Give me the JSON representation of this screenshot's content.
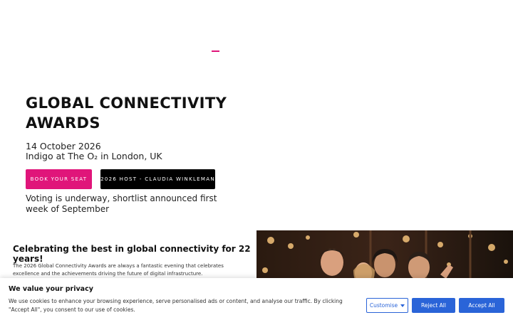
{
  "hero": {
    "title": "GLOBAL CONNECTIVITY AWARDS",
    "date": " 14 October 2026",
    "venue": "Indigo at The O₂ in London, UK",
    "book_label": "BOOK YOUR SEAT",
    "host_label": "2026 HOST - CLAUDIA WINKLEMAN",
    "note": "Voting is underway, shortlist announced first week of September"
  },
  "section": {
    "heading": "Celebrating the best in global connectivity for 22 years!",
    "body": "The 2026 Global Connectivity Awards are always a fantastic evening that celebrates excellence and the achievements driving the future of digital infrastructure."
  },
  "cookie": {
    "title": "We value your privacy",
    "text": "We use cookies to enhance your browsing experience, serve personalised ads or content, and analyse our traffic. By clicking \"Accept All\", you consent to our use of cookies.",
    "customise_label": "Customise",
    "reject_label": "Reject All",
    "accept_label": "Accept All"
  },
  "colors": {
    "accent": "#e0157a",
    "dark_button": "#000000",
    "cookie_blue": "#2a64d8"
  },
  "icons": {
    "customise_caret": "chevron-down-icon"
  }
}
